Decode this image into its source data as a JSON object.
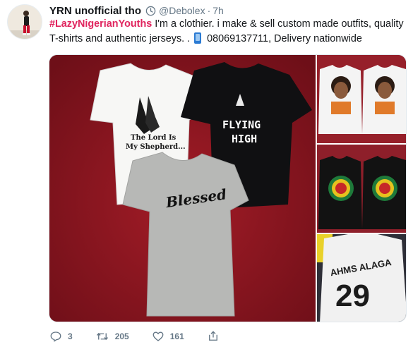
{
  "user": {
    "display_name": "YRN unofficial tho",
    "handle": "@Debolex",
    "time": "7h",
    "verified_icon": "clock-badge-icon"
  },
  "tweet": {
    "hashtag": "#LazyNigerianYouths",
    "line1_rest": " I'm a clothier. i make & sell custom made outfits, quality",
    "line2_start": "T-shirts and authentic jerseys. . ",
    "line2_end": " 08069137711, Delivery nationwide"
  },
  "media": {
    "main_shirt_left_text": "The Lord Is My Shepherd...",
    "main_shirt_right_text_1": "FLYING",
    "main_shirt_right_text_2": "HIGH",
    "main_shirt_bottom_text": "Blessed",
    "jersey_name": "AHMS ALAGA",
    "jersey_number": "29"
  },
  "actions": {
    "reply_count": "3",
    "retweet_count": "205",
    "like_count": "161"
  },
  "colors": {
    "hashtag": "#e0245e",
    "muted": "#657786",
    "text": "#14171a"
  }
}
